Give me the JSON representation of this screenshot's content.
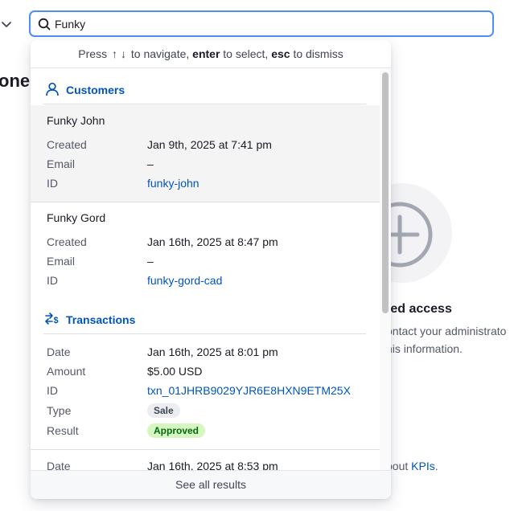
{
  "background": {
    "heading_fragment": "one",
    "restricted_title": "ted access",
    "restricted_line1": "ontact your administrato",
    "restricted_line2": "his information.",
    "link_prefix": "bout ",
    "link_text": "KPIs",
    "link_suffix": "."
  },
  "search": {
    "value": "Funky",
    "placeholder": ""
  },
  "dropdown": {
    "hint": {
      "press": "Press",
      "up": "↑",
      "down": "↓",
      "navigate": "to navigate,",
      "enter": "enter",
      "select": "to select,",
      "esc": "esc",
      "dismiss": "to dismiss"
    },
    "customers": {
      "label": "Customers",
      "items": [
        {
          "name": "Funky John",
          "created_label": "Created",
          "created": "Jan 9th, 2025 at 7:41 pm",
          "email_label": "Email",
          "email": "–",
          "id_label": "ID",
          "id": "funky-john"
        },
        {
          "name": "Funky Gord",
          "created_label": "Created",
          "created": "Jan 16th, 2025 at 8:47 pm",
          "email_label": "Email",
          "email": "–",
          "id_label": "ID",
          "id": "funky-gord-cad"
        }
      ]
    },
    "transactions": {
      "label": "Transactions",
      "items": [
        {
          "date_label": "Date",
          "date": "Jan 16th, 2025 at 8:01 pm",
          "amount_label": "Amount",
          "amount": "$5.00 USD",
          "id_label": "ID",
          "id": "txn_01JHRB9029YJR6E8HXN9ETM25X",
          "type_label": "Type",
          "type": "Sale",
          "result_label": "Result",
          "result": "Approved"
        },
        {
          "date_label": "Date",
          "date": "Jan 16th, 2025 at 8:53 pm"
        }
      ]
    },
    "see_all": "See all results"
  },
  "colors": {
    "accent": "#0055bc",
    "focus_ring": "#4f8ef7",
    "approved_bg": "#d7f7c2",
    "approved_text": "#05690d"
  }
}
